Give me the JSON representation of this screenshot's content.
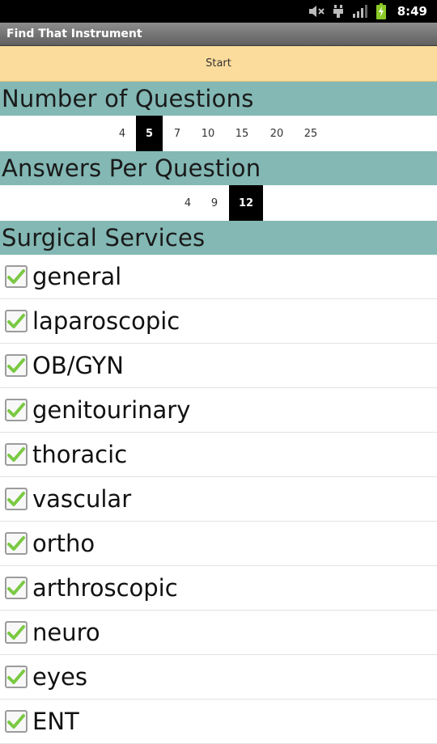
{
  "status": {
    "time": "8:49"
  },
  "app": {
    "title": "Find That Instrument",
    "start_label": "Start"
  },
  "questions": {
    "header": "Number of Questions",
    "options": [
      "4",
      "5",
      "7",
      "10",
      "15",
      "20",
      "25"
    ],
    "selected": "5"
  },
  "answers": {
    "header": "Answers Per Question",
    "options": [
      "4",
      "9",
      "12"
    ],
    "selected": "12"
  },
  "services": {
    "header": "Surgical Services",
    "items": [
      {
        "label": "general",
        "checked": true
      },
      {
        "label": "laparoscopic",
        "checked": true
      },
      {
        "label": "OB/GYN",
        "checked": true
      },
      {
        "label": "genitourinary",
        "checked": true
      },
      {
        "label": "thoracic",
        "checked": true
      },
      {
        "label": "vascular",
        "checked": true
      },
      {
        "label": "ortho",
        "checked": true
      },
      {
        "label": "arthroscopic",
        "checked": true
      },
      {
        "label": "neuro",
        "checked": true
      },
      {
        "label": "eyes",
        "checked": true
      },
      {
        "label": "ENT",
        "checked": true
      }
    ]
  },
  "colors": {
    "check_green": "#7ac943",
    "section_header_bg": "#83b8b4",
    "start_bg": "#fcdc9c"
  }
}
